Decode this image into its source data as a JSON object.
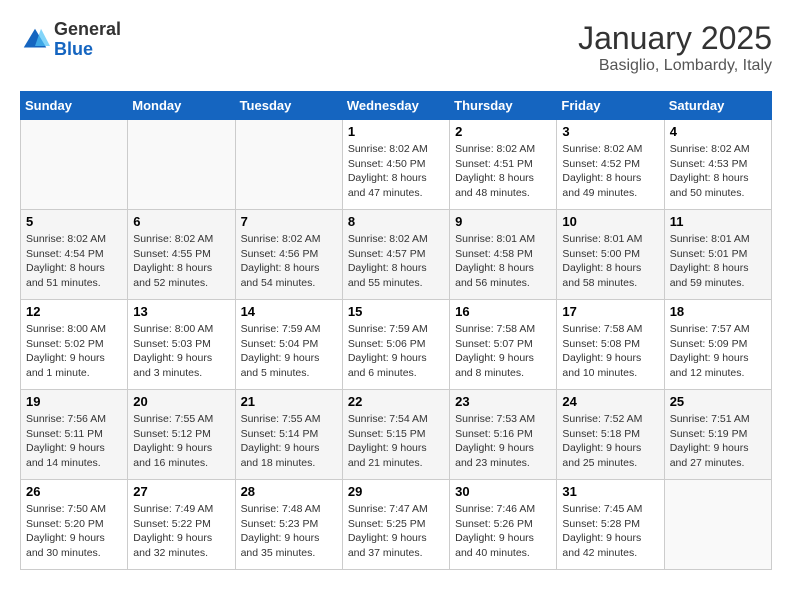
{
  "header": {
    "logo_general": "General",
    "logo_blue": "Blue",
    "month": "January 2025",
    "location": "Basiglio, Lombardy, Italy"
  },
  "weekdays": [
    "Sunday",
    "Monday",
    "Tuesday",
    "Wednesday",
    "Thursday",
    "Friday",
    "Saturday"
  ],
  "weeks": [
    [
      {
        "day": "",
        "sunrise": "",
        "sunset": "",
        "daylight": ""
      },
      {
        "day": "",
        "sunrise": "",
        "sunset": "",
        "daylight": ""
      },
      {
        "day": "",
        "sunrise": "",
        "sunset": "",
        "daylight": ""
      },
      {
        "day": "1",
        "sunrise": "Sunrise: 8:02 AM",
        "sunset": "Sunset: 4:50 PM",
        "daylight": "Daylight: 8 hours and 47 minutes."
      },
      {
        "day": "2",
        "sunrise": "Sunrise: 8:02 AM",
        "sunset": "Sunset: 4:51 PM",
        "daylight": "Daylight: 8 hours and 48 minutes."
      },
      {
        "day": "3",
        "sunrise": "Sunrise: 8:02 AM",
        "sunset": "Sunset: 4:52 PM",
        "daylight": "Daylight: 8 hours and 49 minutes."
      },
      {
        "day": "4",
        "sunrise": "Sunrise: 8:02 AM",
        "sunset": "Sunset: 4:53 PM",
        "daylight": "Daylight: 8 hours and 50 minutes."
      }
    ],
    [
      {
        "day": "5",
        "sunrise": "Sunrise: 8:02 AM",
        "sunset": "Sunset: 4:54 PM",
        "daylight": "Daylight: 8 hours and 51 minutes."
      },
      {
        "day": "6",
        "sunrise": "Sunrise: 8:02 AM",
        "sunset": "Sunset: 4:55 PM",
        "daylight": "Daylight: 8 hours and 52 minutes."
      },
      {
        "day": "7",
        "sunrise": "Sunrise: 8:02 AM",
        "sunset": "Sunset: 4:56 PM",
        "daylight": "Daylight: 8 hours and 54 minutes."
      },
      {
        "day": "8",
        "sunrise": "Sunrise: 8:02 AM",
        "sunset": "Sunset: 4:57 PM",
        "daylight": "Daylight: 8 hours and 55 minutes."
      },
      {
        "day": "9",
        "sunrise": "Sunrise: 8:01 AM",
        "sunset": "Sunset: 4:58 PM",
        "daylight": "Daylight: 8 hours and 56 minutes."
      },
      {
        "day": "10",
        "sunrise": "Sunrise: 8:01 AM",
        "sunset": "Sunset: 5:00 PM",
        "daylight": "Daylight: 8 hours and 58 minutes."
      },
      {
        "day": "11",
        "sunrise": "Sunrise: 8:01 AM",
        "sunset": "Sunset: 5:01 PM",
        "daylight": "Daylight: 8 hours and 59 minutes."
      }
    ],
    [
      {
        "day": "12",
        "sunrise": "Sunrise: 8:00 AM",
        "sunset": "Sunset: 5:02 PM",
        "daylight": "Daylight: 9 hours and 1 minute."
      },
      {
        "day": "13",
        "sunrise": "Sunrise: 8:00 AM",
        "sunset": "Sunset: 5:03 PM",
        "daylight": "Daylight: 9 hours and 3 minutes."
      },
      {
        "day": "14",
        "sunrise": "Sunrise: 7:59 AM",
        "sunset": "Sunset: 5:04 PM",
        "daylight": "Daylight: 9 hours and 5 minutes."
      },
      {
        "day": "15",
        "sunrise": "Sunrise: 7:59 AM",
        "sunset": "Sunset: 5:06 PM",
        "daylight": "Daylight: 9 hours and 6 minutes."
      },
      {
        "day": "16",
        "sunrise": "Sunrise: 7:58 AM",
        "sunset": "Sunset: 5:07 PM",
        "daylight": "Daylight: 9 hours and 8 minutes."
      },
      {
        "day": "17",
        "sunrise": "Sunrise: 7:58 AM",
        "sunset": "Sunset: 5:08 PM",
        "daylight": "Daylight: 9 hours and 10 minutes."
      },
      {
        "day": "18",
        "sunrise": "Sunrise: 7:57 AM",
        "sunset": "Sunset: 5:09 PM",
        "daylight": "Daylight: 9 hours and 12 minutes."
      }
    ],
    [
      {
        "day": "19",
        "sunrise": "Sunrise: 7:56 AM",
        "sunset": "Sunset: 5:11 PM",
        "daylight": "Daylight: 9 hours and 14 minutes."
      },
      {
        "day": "20",
        "sunrise": "Sunrise: 7:55 AM",
        "sunset": "Sunset: 5:12 PM",
        "daylight": "Daylight: 9 hours and 16 minutes."
      },
      {
        "day": "21",
        "sunrise": "Sunrise: 7:55 AM",
        "sunset": "Sunset: 5:14 PM",
        "daylight": "Daylight: 9 hours and 18 minutes."
      },
      {
        "day": "22",
        "sunrise": "Sunrise: 7:54 AM",
        "sunset": "Sunset: 5:15 PM",
        "daylight": "Daylight: 9 hours and 21 minutes."
      },
      {
        "day": "23",
        "sunrise": "Sunrise: 7:53 AM",
        "sunset": "Sunset: 5:16 PM",
        "daylight": "Daylight: 9 hours and 23 minutes."
      },
      {
        "day": "24",
        "sunrise": "Sunrise: 7:52 AM",
        "sunset": "Sunset: 5:18 PM",
        "daylight": "Daylight: 9 hours and 25 minutes."
      },
      {
        "day": "25",
        "sunrise": "Sunrise: 7:51 AM",
        "sunset": "Sunset: 5:19 PM",
        "daylight": "Daylight: 9 hours and 27 minutes."
      }
    ],
    [
      {
        "day": "26",
        "sunrise": "Sunrise: 7:50 AM",
        "sunset": "Sunset: 5:20 PM",
        "daylight": "Daylight: 9 hours and 30 minutes."
      },
      {
        "day": "27",
        "sunrise": "Sunrise: 7:49 AM",
        "sunset": "Sunset: 5:22 PM",
        "daylight": "Daylight: 9 hours and 32 minutes."
      },
      {
        "day": "28",
        "sunrise": "Sunrise: 7:48 AM",
        "sunset": "Sunset: 5:23 PM",
        "daylight": "Daylight: 9 hours and 35 minutes."
      },
      {
        "day": "29",
        "sunrise": "Sunrise: 7:47 AM",
        "sunset": "Sunset: 5:25 PM",
        "daylight": "Daylight: 9 hours and 37 minutes."
      },
      {
        "day": "30",
        "sunrise": "Sunrise: 7:46 AM",
        "sunset": "Sunset: 5:26 PM",
        "daylight": "Daylight: 9 hours and 40 minutes."
      },
      {
        "day": "31",
        "sunrise": "Sunrise: 7:45 AM",
        "sunset": "Sunset: 5:28 PM",
        "daylight": "Daylight: 9 hours and 42 minutes."
      },
      {
        "day": "",
        "sunrise": "",
        "sunset": "",
        "daylight": ""
      }
    ]
  ]
}
